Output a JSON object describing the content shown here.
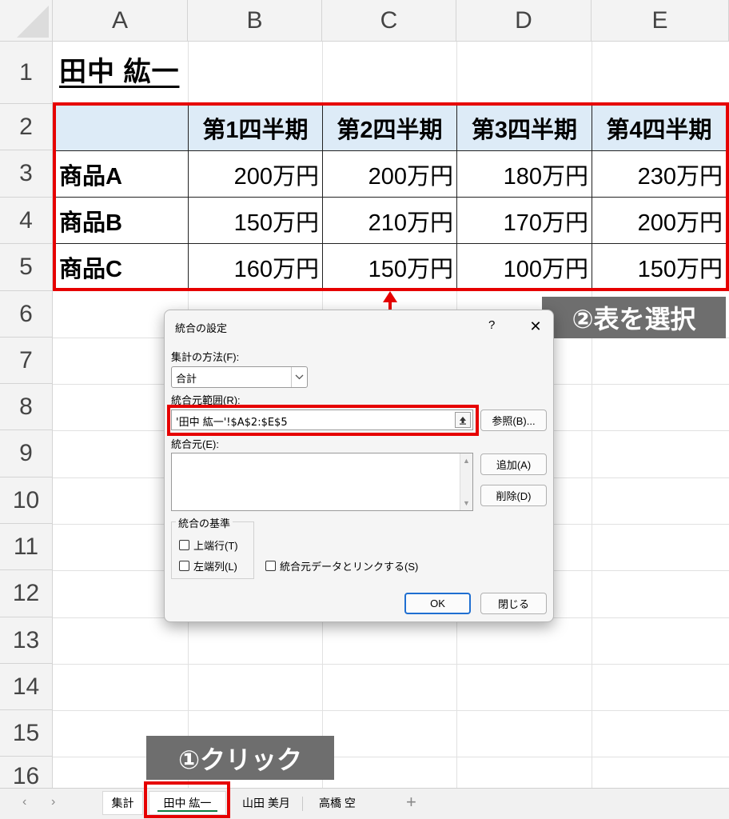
{
  "sheet": {
    "columns": [
      "A",
      "B",
      "C",
      "D",
      "E"
    ],
    "rows": [
      "1",
      "2",
      "3",
      "4",
      "5",
      "6",
      "7",
      "8",
      "9",
      "10",
      "11",
      "12",
      "13",
      "14",
      "15",
      "16"
    ],
    "title": "田中 紘一",
    "table": {
      "headers": [
        "",
        "第1四半期",
        "第2四半期",
        "第3四半期",
        "第4四半期"
      ],
      "rows": [
        {
          "label": "商品A",
          "values": [
            "200万円",
            "200万円",
            "180万円",
            "230万円"
          ]
        },
        {
          "label": "商品B",
          "values": [
            "150万円",
            "210万円",
            "170万円",
            "200万円"
          ]
        },
        {
          "label": "商品C",
          "values": [
            "160万円",
            "150万円",
            "100万円",
            "150万円"
          ]
        }
      ]
    }
  },
  "annotations": {
    "step1": "①クリック",
    "step2": "②表を選択",
    "highlight_color": "#e60000",
    "callout_color": "#6e6e6e"
  },
  "dialog": {
    "title": "統合の設定",
    "help": "?",
    "close": "✕",
    "function_label": "集計の方法(F):",
    "function_value": "合計",
    "reference_label": "統合元範囲(R):",
    "reference_value": "'田中 紘一'!$A$2:$E$5",
    "browse_button": "参照(B)...",
    "all_references_label": "統合元(E):",
    "add_button": "追加(A)",
    "delete_button": "削除(D)",
    "use_labels_group": "統合の基準",
    "top_row": "上端行(T)",
    "left_column": "左端列(L)",
    "create_links": "統合元データとリンクする(S)",
    "ok_button": "OK",
    "close_button": "閉じる"
  },
  "tabs": {
    "nav_prev": "‹",
    "nav_next": "›",
    "sheets": [
      "集計",
      "田中 紘一",
      "山田 美月",
      "高橋 空"
    ],
    "active": "田中 紘一",
    "add": "+"
  }
}
